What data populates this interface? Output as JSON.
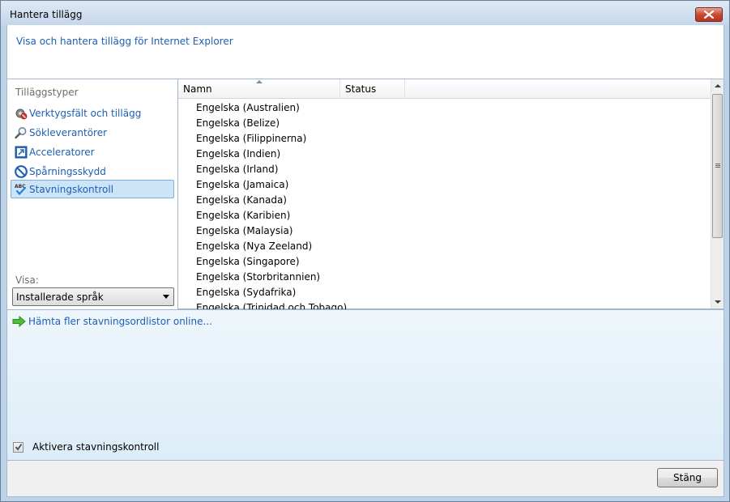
{
  "window": {
    "title": "Hantera tillägg"
  },
  "header": {
    "text": "Visa och hantera tillägg för Internet Explorer"
  },
  "types": {
    "heading": "Tilläggstyper",
    "items": [
      {
        "label": "Verktygsfält och tillägg",
        "icon": "gear-icon"
      },
      {
        "label": "Sökleverantörer",
        "icon": "magnifier-icon"
      },
      {
        "label": "Acceleratorer",
        "icon": "accelerator-icon"
      },
      {
        "label": "Spårningsskydd",
        "icon": "no-entry-icon"
      },
      {
        "label": "Stavningskontroll",
        "icon": "spellcheck-icon",
        "selected": true
      }
    ]
  },
  "show": {
    "label": "Visa:",
    "selected": "Installerade språk"
  },
  "list": {
    "columns": [
      "Namn",
      "Status"
    ],
    "rows": [
      "Engelska (Australien)",
      "Engelska (Belize)",
      "Engelska (Filippinerna)",
      "Engelska (Indien)",
      "Engelska (Irland)",
      "Engelska (Jamaica)",
      "Engelska (Kanada)",
      "Engelska (Karibien)",
      "Engelska (Malaysia)",
      "Engelska (Nya Zeeland)",
      "Engelska (Singapore)",
      "Engelska (Storbritannien)",
      "Engelska (Sydafrika)",
      "Engelska (Trinidad och Tobago)"
    ]
  },
  "details": {
    "more_link": "Hämta fler stavningsordlistor online...",
    "enable_label": "Aktivera stavningskontroll",
    "enable_checked": true
  },
  "footer": {
    "close_label": "Stäng"
  },
  "colors": {
    "link": "#1e5fb3",
    "selection": "#cce4f7",
    "frame": "#bcd3ea"
  }
}
